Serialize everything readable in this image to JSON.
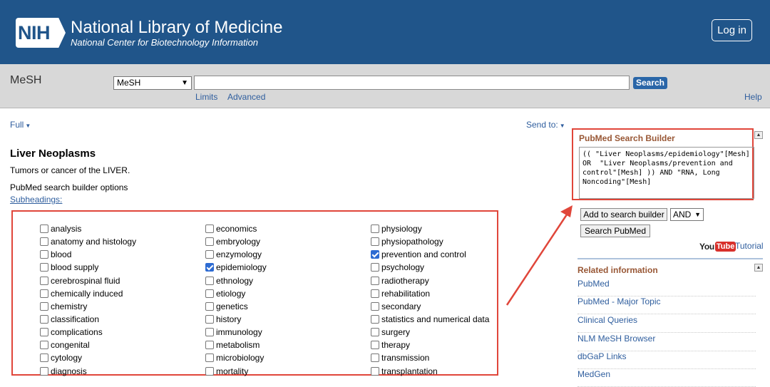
{
  "header": {
    "logo_text": "NIH",
    "org_name": "National Library of Medicine",
    "org_sub": "National Center for Biotechnology Information",
    "login_label": "Log in"
  },
  "searchbar": {
    "db_title": "MeSH",
    "db_selected": "MeSH",
    "search_value": "",
    "search_button": "Search",
    "limits_link": "Limits",
    "advanced_link": "Advanced",
    "help_link": "Help"
  },
  "main": {
    "display_format": "Full",
    "send_to": "Send to:",
    "title": "Liver Neoplasms",
    "definition": "Tumors or cancer of the LIVER.",
    "builder_options": "PubMed search builder options",
    "subheadings_link": "Subheadings:",
    "subheadings": {
      "col1": [
        {
          "label": "analysis",
          "checked": false
        },
        {
          "label": "anatomy and histology",
          "checked": false
        },
        {
          "label": "blood",
          "checked": false
        },
        {
          "label": "blood supply",
          "checked": false
        },
        {
          "label": "cerebrospinal fluid",
          "checked": false
        },
        {
          "label": "chemically induced",
          "checked": false
        },
        {
          "label": "chemistry",
          "checked": false
        },
        {
          "label": "classification",
          "checked": false
        },
        {
          "label": "complications",
          "checked": false
        },
        {
          "label": "congenital",
          "checked": false
        },
        {
          "label": "cytology",
          "checked": false
        },
        {
          "label": "diagnosis",
          "checked": false
        }
      ],
      "col2": [
        {
          "label": "economics",
          "checked": false
        },
        {
          "label": "embryology",
          "checked": false
        },
        {
          "label": "enzymology",
          "checked": false
        },
        {
          "label": "epidemiology",
          "checked": true
        },
        {
          "label": "ethnology",
          "checked": false
        },
        {
          "label": "etiology",
          "checked": false
        },
        {
          "label": "genetics",
          "checked": false
        },
        {
          "label": "history",
          "checked": false
        },
        {
          "label": "immunology",
          "checked": false
        },
        {
          "label": "metabolism",
          "checked": false
        },
        {
          "label": "microbiology",
          "checked": false
        },
        {
          "label": "mortality",
          "checked": false
        }
      ],
      "col3": [
        {
          "label": "physiology",
          "checked": false
        },
        {
          "label": "physiopathology",
          "checked": false
        },
        {
          "label": "prevention and control",
          "checked": true
        },
        {
          "label": "psychology",
          "checked": false
        },
        {
          "label": "radiotherapy",
          "checked": false
        },
        {
          "label": "rehabilitation",
          "checked": false
        },
        {
          "label": "secondary",
          "checked": false
        },
        {
          "label": "statistics and numerical data",
          "checked": false
        },
        {
          "label": "surgery",
          "checked": false
        },
        {
          "label": "therapy",
          "checked": false
        },
        {
          "label": "transmission",
          "checked": false
        },
        {
          "label": "transplantation",
          "checked": false
        }
      ]
    }
  },
  "sidebar": {
    "builder_title": "PubMed Search Builder",
    "builder_query": "(( \"Liver Neoplasms/epidemiology\"[Mesh] OR  \"Liver Neoplasms/prevention and control\"[Mesh] )) AND \"RNA, Long Noncoding\"[Mesh]",
    "add_button": "Add to search builder",
    "operator": "AND",
    "search_pubmed_button": "Search PubMed",
    "youtube_you": "You",
    "youtube_tube": "Tube",
    "tutorial_link": "Tutorial",
    "related_title": "Related information",
    "related_items": [
      "PubMed",
      "PubMed - Major Topic",
      "Clinical Queries",
      "NLM MeSH Browser",
      "dbGaP Links",
      "MedGen"
    ]
  },
  "colors": {
    "header_bg": "#20558a",
    "link": "#2f5e9e",
    "annotation_red": "#e0463a",
    "panel_title": "#985735",
    "checkbox_checked": "#2d6bd2"
  }
}
